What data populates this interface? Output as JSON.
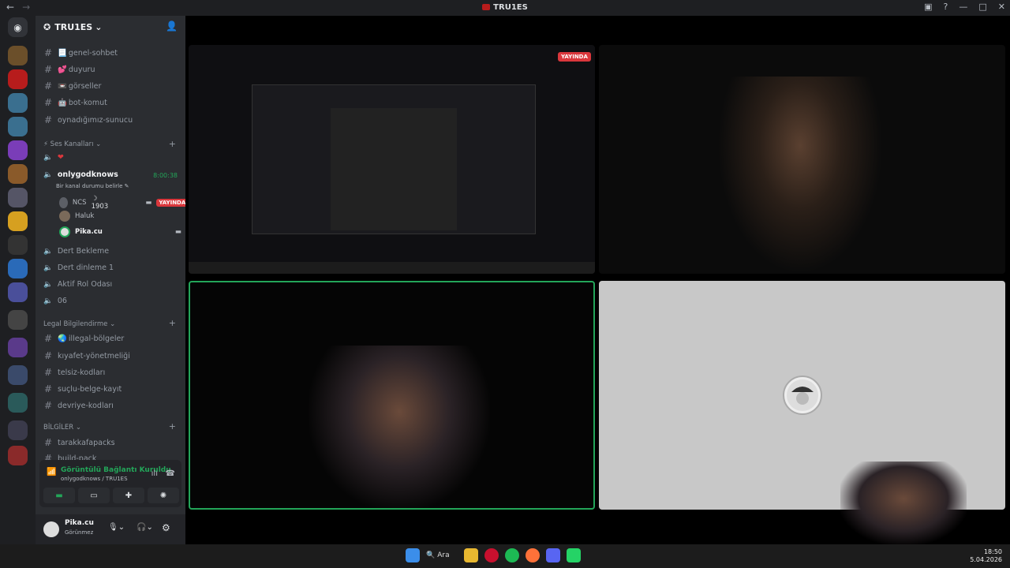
{
  "window": {
    "title": "TRU1ES"
  },
  "server": {
    "name": "TRU1ES"
  },
  "channels_top": [
    {
      "name": "genel-sohbet",
      "emoji": "📃"
    },
    {
      "name": "duyuru",
      "emoji": "💕"
    },
    {
      "name": "görseller",
      "emoji": "📼"
    },
    {
      "name": "bot-komut",
      "emoji": "🤖"
    },
    {
      "name": "oynadığımız-sunucu",
      "emoji": ""
    }
  ],
  "voice_category": {
    "label": "Ses Kanalları"
  },
  "active_voice": {
    "name": "onlygodknows",
    "timer": "8:00:38",
    "status_placeholder": "Bir kanal durumu belirle",
    "members": [
      {
        "name": "NCS",
        "badge": "1903",
        "live": "YAYINDA"
      },
      {
        "name": "Haluk"
      },
      {
        "name": "Pika.cu"
      }
    ]
  },
  "voice_channels": [
    "Dert Bekleme",
    "Dert dinleme 1",
    "Aktif Rol Odası",
    "06"
  ],
  "legal_category": {
    "label": "Legal Bilgilendirme"
  },
  "legal_channels": [
    "illegal-bölgeler",
    "kıyafet-yönetmeliği",
    "telsiz-kodları",
    "suçlu-belge-kayıt",
    "devriye-kodları"
  ],
  "info_category": {
    "label": "BİLGİLER"
  },
  "info_channels": [
    "tarakkafapacks",
    "build-pack"
  ],
  "voice_panel": {
    "title": "Görüntülü Bağlantı Kuruldu",
    "subtitle": "onlygodknows / TRU1ES"
  },
  "user": {
    "name": "Pika.cu",
    "status": "Görünmez"
  },
  "stage": {
    "live_badge": "YAYINDA"
  },
  "taskbar": {
    "search_label": "Ara",
    "time": "18:50",
    "date": "5.04.2026"
  },
  "colors": {
    "accent_green": "#23a559",
    "live_red": "#da373c",
    "sidebar": "#2b2d31"
  }
}
